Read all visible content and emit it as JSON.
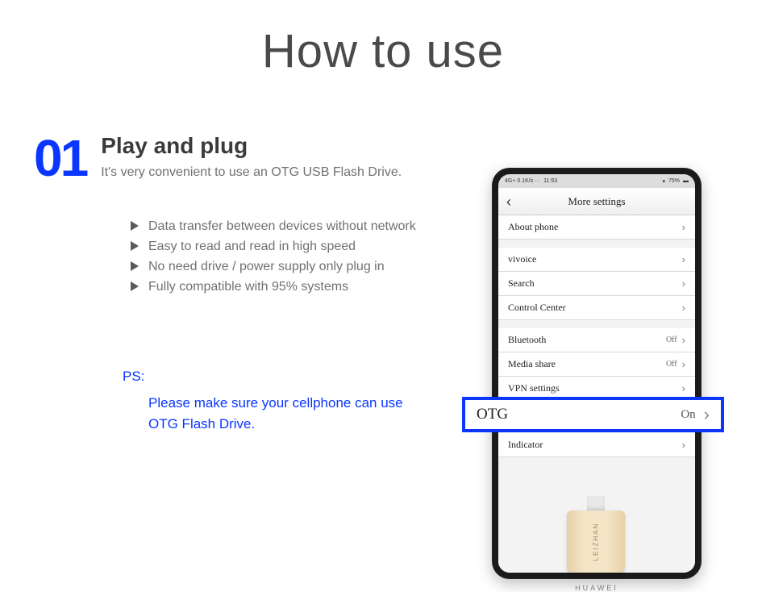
{
  "page": {
    "title": "How to use"
  },
  "step": {
    "number": "01",
    "title": "Play and plug",
    "subtitle": "It's very convenient to use an OTG USB Flash Drive.",
    "bullets": [
      "Data transfer between devices without network",
      "Easy to read and read in high speed",
      "No need drive / power supply only plug in",
      "Fully compatible with 95% systems"
    ],
    "ps_label": "PS:",
    "ps_text": "Please make sure your cellphone can use OTG Flash Drive."
  },
  "phone": {
    "status": {
      "left": "4G+  0.1K/s ···",
      "time": "11:53",
      "right": "75%"
    },
    "nav_title": "More settings",
    "rows": [
      {
        "label": "About phone",
        "state": "",
        "gap": false
      },
      {
        "label": "vivoice",
        "state": "",
        "gap": true
      },
      {
        "label": "Search",
        "state": "",
        "gap": false
      },
      {
        "label": "Control Center",
        "state": "",
        "gap": false
      },
      {
        "label": "Bluetooth",
        "state": "Off",
        "gap": true
      },
      {
        "label": "Media share",
        "state": "Off",
        "gap": false
      },
      {
        "label": "VPN settings",
        "state": "",
        "gap": false
      },
      {
        "label": "OTG",
        "state": "On",
        "gap": false
      },
      {
        "label": "Indicator",
        "state": "",
        "gap": true
      }
    ],
    "brand": "HUAWEI"
  },
  "callout": {
    "label": "OTG",
    "state": "On"
  },
  "usb": {
    "brand": "LEIZHAN"
  }
}
